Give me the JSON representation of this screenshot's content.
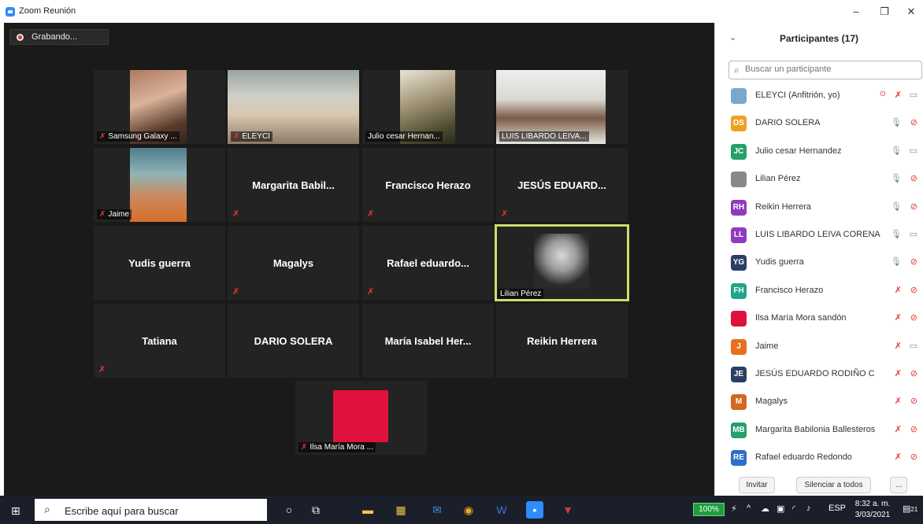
{
  "window": {
    "title": "Zoom Reunión",
    "min_icon": "minimize-icon",
    "restore_icon": "restore-icon",
    "close_icon": "close-icon"
  },
  "recording": {
    "label": "Grabando..."
  },
  "tiles": {
    "t1": "Samsung Galaxy ...",
    "t2": "ELEYCI",
    "t3": "Julio cesar  Hernan...",
    "t4": "LUIS LIBARDO LEIVA...",
    "t5": "Jaime",
    "t6": "Margarita  Babil...",
    "t7": "Francisco Herazo",
    "t8": "JESÚS EDUARD...",
    "t9": "Yudis guerra",
    "t10": "Magalys",
    "t11": "Rafael  eduardo...",
    "t12": "Lilian Pérez",
    "t13": "Tatiana",
    "t14": "DARIO SOLERA",
    "t15": "María Isabel Her...",
    "t16": "Reikin Herrera",
    "t17": "Ilsa María Mora ..."
  },
  "panel": {
    "title": "Participantes (17)",
    "search_placeholder": "Buscar un participante",
    "participants": [
      {
        "initials": "",
        "name": "ELEYCI (Anfitrión, yo)",
        "color": "#7aa8c9",
        "mic": "muted",
        "cam": "on"
      },
      {
        "initials": "DS",
        "name": "DARIO SOLERA",
        "color": "#f0a020",
        "mic": "on",
        "cam": "off"
      },
      {
        "initials": "JC",
        "name": "Julio cesar  Hernandez",
        "color": "#24a06a",
        "mic": "on",
        "cam": "on"
      },
      {
        "initials": "",
        "name": "Lilian Pérez",
        "color": "#888888",
        "mic": "on",
        "cam": "off"
      },
      {
        "initials": "RH",
        "name": "Reikin Herrera",
        "color": "#8e3bbf",
        "mic": "on",
        "cam": "off"
      },
      {
        "initials": "LL",
        "name": "LUIS LIBARDO LEIVA CORENA",
        "color": "#8e3bbf",
        "mic": "on",
        "cam": "on"
      },
      {
        "initials": "YG",
        "name": "Yudis guerra",
        "color": "#2c3e66",
        "mic": "on",
        "cam": "off"
      },
      {
        "initials": "FH",
        "name": "Francisco Herazo",
        "color": "#1ea58a",
        "mic": "muted",
        "cam": "off"
      },
      {
        "initials": "",
        "name": "Ilsa María Mora sandón",
        "color": "#e0113d",
        "mic": "muted",
        "cam": "off"
      },
      {
        "initials": "J",
        "name": "Jaime",
        "color": "#e8701c",
        "mic": "muted",
        "cam": "on"
      },
      {
        "initials": "JE",
        "name": "JESÚS EDUARDO RODIÑO C",
        "color": "#2c3e66",
        "mic": "muted",
        "cam": "off"
      },
      {
        "initials": "M",
        "name": "Magalys",
        "color": "#d2691e",
        "mic": "muted",
        "cam": "off"
      },
      {
        "initials": "MB",
        "name": "Margarita  Babilonia Ballesteros",
        "color": "#24a06a",
        "mic": "muted",
        "cam": "off"
      },
      {
        "initials": "RE",
        "name": "Rafael eduardo Redondo",
        "color": "#2d6ec9",
        "mic": "muted",
        "cam": "off"
      }
    ],
    "invite_label": "Invitar",
    "mute_all_label": "Silenciar a todos",
    "more_label": "..."
  },
  "taskbar": {
    "search_placeholder": "Escribe aquí para buscar",
    "battery": "100%",
    "lang": "ESP",
    "time": "8:32 a. m.",
    "date": "3/03/2021",
    "notif_count": "21"
  }
}
